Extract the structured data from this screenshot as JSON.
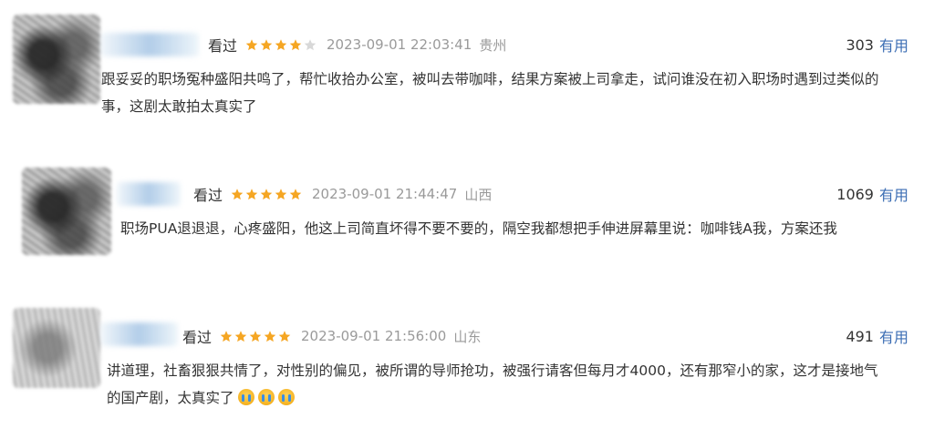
{
  "reviews": [
    {
      "status": "看过",
      "rating": 4,
      "time": "2023-09-01 22:03:41",
      "region": "贵州",
      "useful_count": "303",
      "useful_label": "有用",
      "text": "跟妥妥的职场冤种盛阳共鸣了，帮忙收拾办公室，被叫去带咖啡，结果方案被上司拿走，试问谁没在初入职场时遇到过类似的事，这剧太敢拍太真实了"
    },
    {
      "status": "看过",
      "rating": 5,
      "time": "2023-09-01 21:44:47",
      "region": "山西",
      "useful_count": "1069",
      "useful_label": "有用",
      "text": "职场PUA退退退，心疼盛阳，他这上司简直坏得不要不要的，隔空我都想把手伸进屏幕里说：咖啡钱A我，方案还我"
    },
    {
      "status": "看过",
      "rating": 5,
      "time": "2023-09-01 21:56:00",
      "region": "山东",
      "useful_count": "491",
      "useful_label": "有用",
      "text": "讲道理，社畜狠狠共情了，对性别的偏见，被所谓的导师抢功，被强行请客但每月才4000，还有那窄小的家，这才是接地气的国产剧，太真实了",
      "emoji_name": "crying-face-icon",
      "emoji_count": 3
    }
  ],
  "colors": {
    "star_on": "#f5a623",
    "star_off": "#d8d8d8",
    "useful_link": "#3c6eb4",
    "meta_gray": "#9a9a9a"
  }
}
